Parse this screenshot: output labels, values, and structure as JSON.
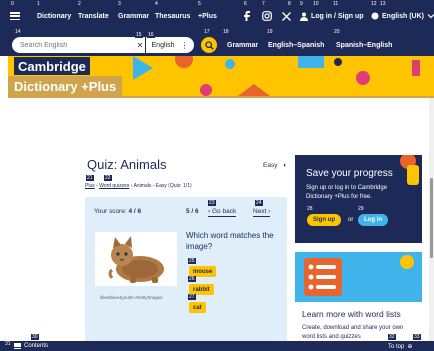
{
  "topnav": {
    "items": [
      "Dictionary",
      "Translate",
      "Grammar",
      "Thesaurus",
      "+Plus"
    ],
    "login_label": "Log in / Sign up",
    "language_label": "English (UK)",
    "hints": [
      "0",
      "1",
      "2",
      "3",
      "4",
      "5",
      "6",
      "7",
      "8",
      "9",
      "10",
      "11",
      "12",
      "13"
    ]
  },
  "search": {
    "placeholder": "Search English",
    "dictionary": "English",
    "quick_links": [
      "Grammar",
      "English–Spanish",
      "Spanish–English"
    ],
    "hints": [
      "14",
      "15",
      "16",
      "17",
      "18",
      "19",
      "20"
    ]
  },
  "hero": {
    "logo_line1": "Cambridge",
    "logo_line2": "Dictionary +Plus"
  },
  "quiz": {
    "title": "Quiz: Animals",
    "level": "Easy",
    "breadcrumb": [
      "Plus",
      "Word quizzes",
      "Animals - Easy (Quiz: 1/1)"
    ],
    "score_label": "Your score:",
    "score_value": "4 / 6",
    "progress": "5 / 6",
    "back_label": "Go back",
    "next_label": "Next",
    "question": "Which word matches the image?",
    "options": [
      "mouse",
      "rabbit",
      "cat"
    ],
    "image_credit": "ilbestblue4you/E+/GettyImages",
    "hints": [
      "21",
      "22",
      "23",
      "24",
      "25",
      "26",
      "27"
    ]
  },
  "progress_card": {
    "title": "Save your progress",
    "text": "Sign up or log in to Cambridge Dictionary +Plus for free.",
    "signup": "Sign up",
    "or": "or",
    "login": "Log in",
    "hints": [
      "28",
      "29"
    ]
  },
  "wordlist_card": {
    "title": "Learn more with word lists",
    "text": "Create, download and share your own word lists and quizzes"
  },
  "footer": {
    "contents": "Contents",
    "top": "To top",
    "hints": [
      "30",
      "31",
      "32",
      "33"
    ]
  },
  "colors": {
    "navy": "#1d2a57",
    "yellow": "#fec400",
    "light_blue": "#dfeef9",
    "sky": "#3fb4ea",
    "orange": "#e8642c"
  }
}
